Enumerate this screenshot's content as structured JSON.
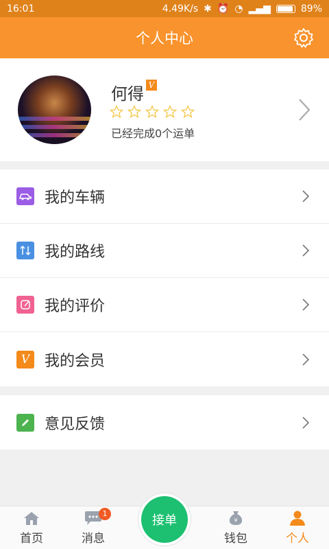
{
  "status_bar": {
    "time": "16:01",
    "net_speed": "4.49K/s",
    "battery": "89%"
  },
  "header": {
    "title": "个人中心",
    "settings_icon": "gear-icon"
  },
  "profile": {
    "name": "何得",
    "vip_badge": "V",
    "rating_stars": 0,
    "rating_max": 5,
    "orders_text": "已经完成0个运单"
  },
  "menu": {
    "group1": [
      {
        "label": "我的车辆",
        "icon": "vehicle-icon",
        "color": "#9b5de5"
      },
      {
        "label": "我的路线",
        "icon": "route-icon",
        "color": "#4a90e2"
      },
      {
        "label": "我的评价",
        "icon": "review-icon",
        "color": "#f06292"
      },
      {
        "label": "我的会员",
        "icon": "vip-icon",
        "color": "#f38a1a"
      }
    ],
    "group2": [
      {
        "label": "意见反馈",
        "icon": "feedback-icon",
        "color": "#4cb34f"
      }
    ]
  },
  "bottom_nav": {
    "home": "首页",
    "messages": "消息",
    "messages_badge": "1",
    "accept": "接单",
    "wallet": "钱包",
    "me": "个人"
  },
  "colors": {
    "accent": "#f9932d",
    "accept_green": "#1dc071",
    "badge_red": "#f15a24"
  }
}
